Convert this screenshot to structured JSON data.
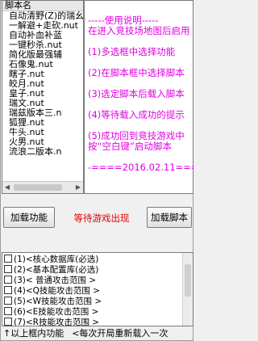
{
  "script_list": {
    "header": "脚本名",
    "items": [
      "自动清野(Z)的瑞幺",
      "一解避+走砍.nut",
      "自动补血补蓝",
      "一键秒杀.nut",
      "简化版最强辅",
      "石像鬼.nut",
      "瞎子.nut",
      "皎月.nut",
      "皇子.nut",
      "瑞文.nut",
      "瑞兹版本三.n",
      "狐狸.nut",
      "牛头.nut",
      "火男.nut",
      "流浪二版本.n"
    ]
  },
  "instructions": {
    "lines": [
      "-----使用说明-----",
      "在进入竞技场地图后启用",
      "(1)多选框中选择功能",
      "(2)在脚本框中选择脚本",
      "(3)选定脚本后载入脚本",
      "(4)等待载入成功的提示",
      "(5)成功回到竞技游戏中",
      "按“空白键”启动脚本",
      "-====2016.02.11====-"
    ]
  },
  "buttons": {
    "load_functions": "加载功能",
    "load_script": "加载脚本"
  },
  "status": "等待游戏出现",
  "function_list": [
    "(1)<核心数据库(必选)",
    "(2)<基本配置库(必选)",
    "(3)< 普通攻击范围  >",
    "(4)<Q技能攻击范围  >",
    "(5)<W技能攻击范围  >",
    "(6)<E技能攻击范围  >",
    "(7)<R技能攻击范围  >"
  ],
  "footer": {
    "left": "↑以上框内功能",
    "right": "<每次开局重新载入一次"
  },
  "colors": {
    "instructions_text": "#e000e0",
    "status_text": "#e00000"
  }
}
